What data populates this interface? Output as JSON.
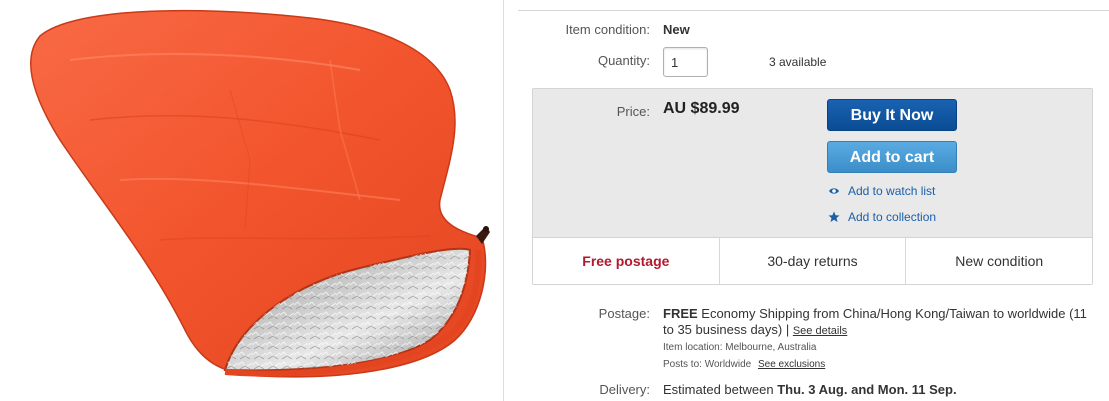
{
  "listing": {
    "item_condition_label": "Item condition:",
    "item_condition_value": "New",
    "quantity_label": "Quantity:",
    "quantity_value": "1",
    "quantity_available": "3 available",
    "price_label": "Price:",
    "price_value": "AU $89.99",
    "buy_now_label": "Buy It Now",
    "add_to_cart_label": "Add to cart",
    "watch_list_label": "Add to watch list",
    "collection_label": "Add to collection",
    "badges": [
      "Free postage",
      "30-day returns",
      "New condition"
    ],
    "postage_label": "Postage:",
    "postage_free": "FREE",
    "postage_line1": " Economy Shipping from China/Hong Kong/Taiwan to worldwide (11",
    "postage_line2": "to 35 business days) | ",
    "see_details": "See details",
    "item_location_label": "Item location:",
    "item_location_value": "Melbourne, Australia",
    "posts_to_label": "Posts to:",
    "posts_to_value": "Worldwide",
    "see_exclusions": "See exclusions",
    "delivery_label": "Delivery:",
    "delivery_prefix": "Estimated between ",
    "delivery_dates": "Thu. 3 Aug. and Mon. 11 Sep."
  },
  "icons": {
    "watch": "eye-icon",
    "collection": "star-icon"
  },
  "colors": {
    "buy_button": "#0f57a6",
    "cart_button": "#4a9ed8",
    "free_postage": "#b2192f",
    "link": "#1b5fa9",
    "bag_orange": "#f2542d"
  }
}
